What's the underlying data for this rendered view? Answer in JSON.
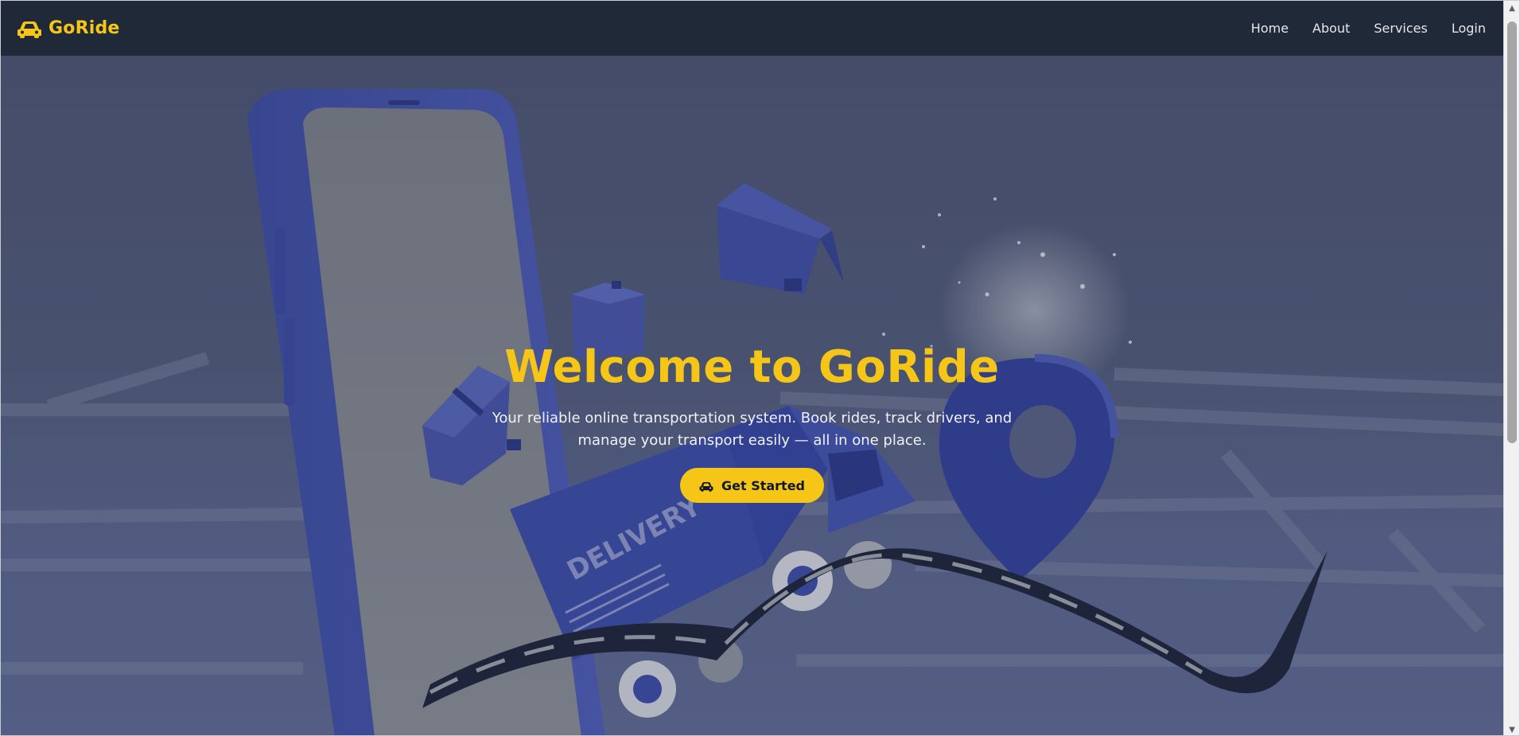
{
  "navbar": {
    "brand": "GoRide",
    "brand_icon": "car-icon",
    "links": [
      "Home",
      "About",
      "Services",
      "Login"
    ]
  },
  "hero": {
    "title": "Welcome to GoRide",
    "subtitle": "Your reliable online transportation system. Book rides, track drivers, and manage your transport easily — all in one place.",
    "cta_label": "Get Started",
    "cta_icon": "car-icon",
    "illustration": [
      "phone",
      "delivery-van",
      "boxes",
      "location-pin",
      "road"
    ]
  },
  "colors": {
    "accent": "#f5c518",
    "navbar_bg": "#1f2937",
    "hero_overlay": "#4a5170"
  }
}
